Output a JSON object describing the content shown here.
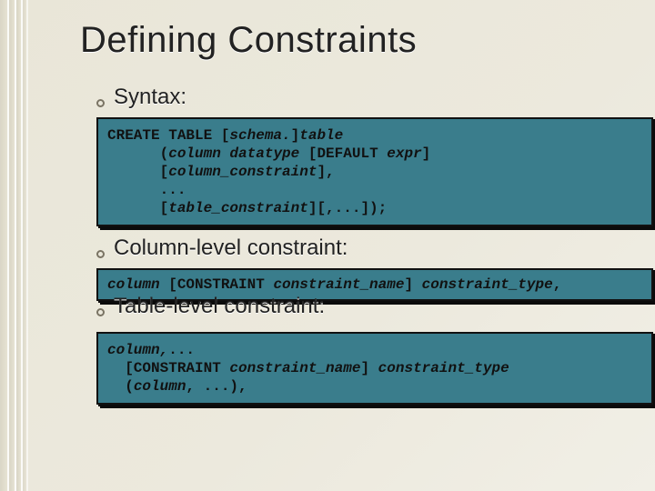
{
  "title": "Defining Constraints",
  "bullets": {
    "syntax": "Syntax:",
    "column_level": "Column-level constraint:",
    "table_level": "Table-level constraint:"
  },
  "code1": {
    "l1a": "CREATE TABLE [",
    "l1b": "schema.",
    "l1c": "]",
    "l1d": "table",
    "l2a": "      (",
    "l2b": "column datatype",
    "l2c": " [DEFAULT ",
    "l2d": "expr",
    "l2e": "]",
    "l3a": "      [",
    "l3b": "column_constraint",
    "l3c": "],",
    "l4": "      ...",
    "l5a": "      [",
    "l5b": "table_constraint",
    "l5c": "][,...]);"
  },
  "code2": {
    "a": "column",
    "b": " [CONSTRAINT ",
    "c": "constraint_name",
    "d": "] ",
    "e": "constraint_type",
    "f": ","
  },
  "code3": {
    "l1a": "column,",
    "l1b": "...",
    "l2a": "  [CONSTRAINT ",
    "l2b": "constraint_name",
    "l2c": "] ",
    "l2d": "constraint_type",
    "l3a": "  (",
    "l3b": "column",
    "l3c": ", ...),"
  }
}
